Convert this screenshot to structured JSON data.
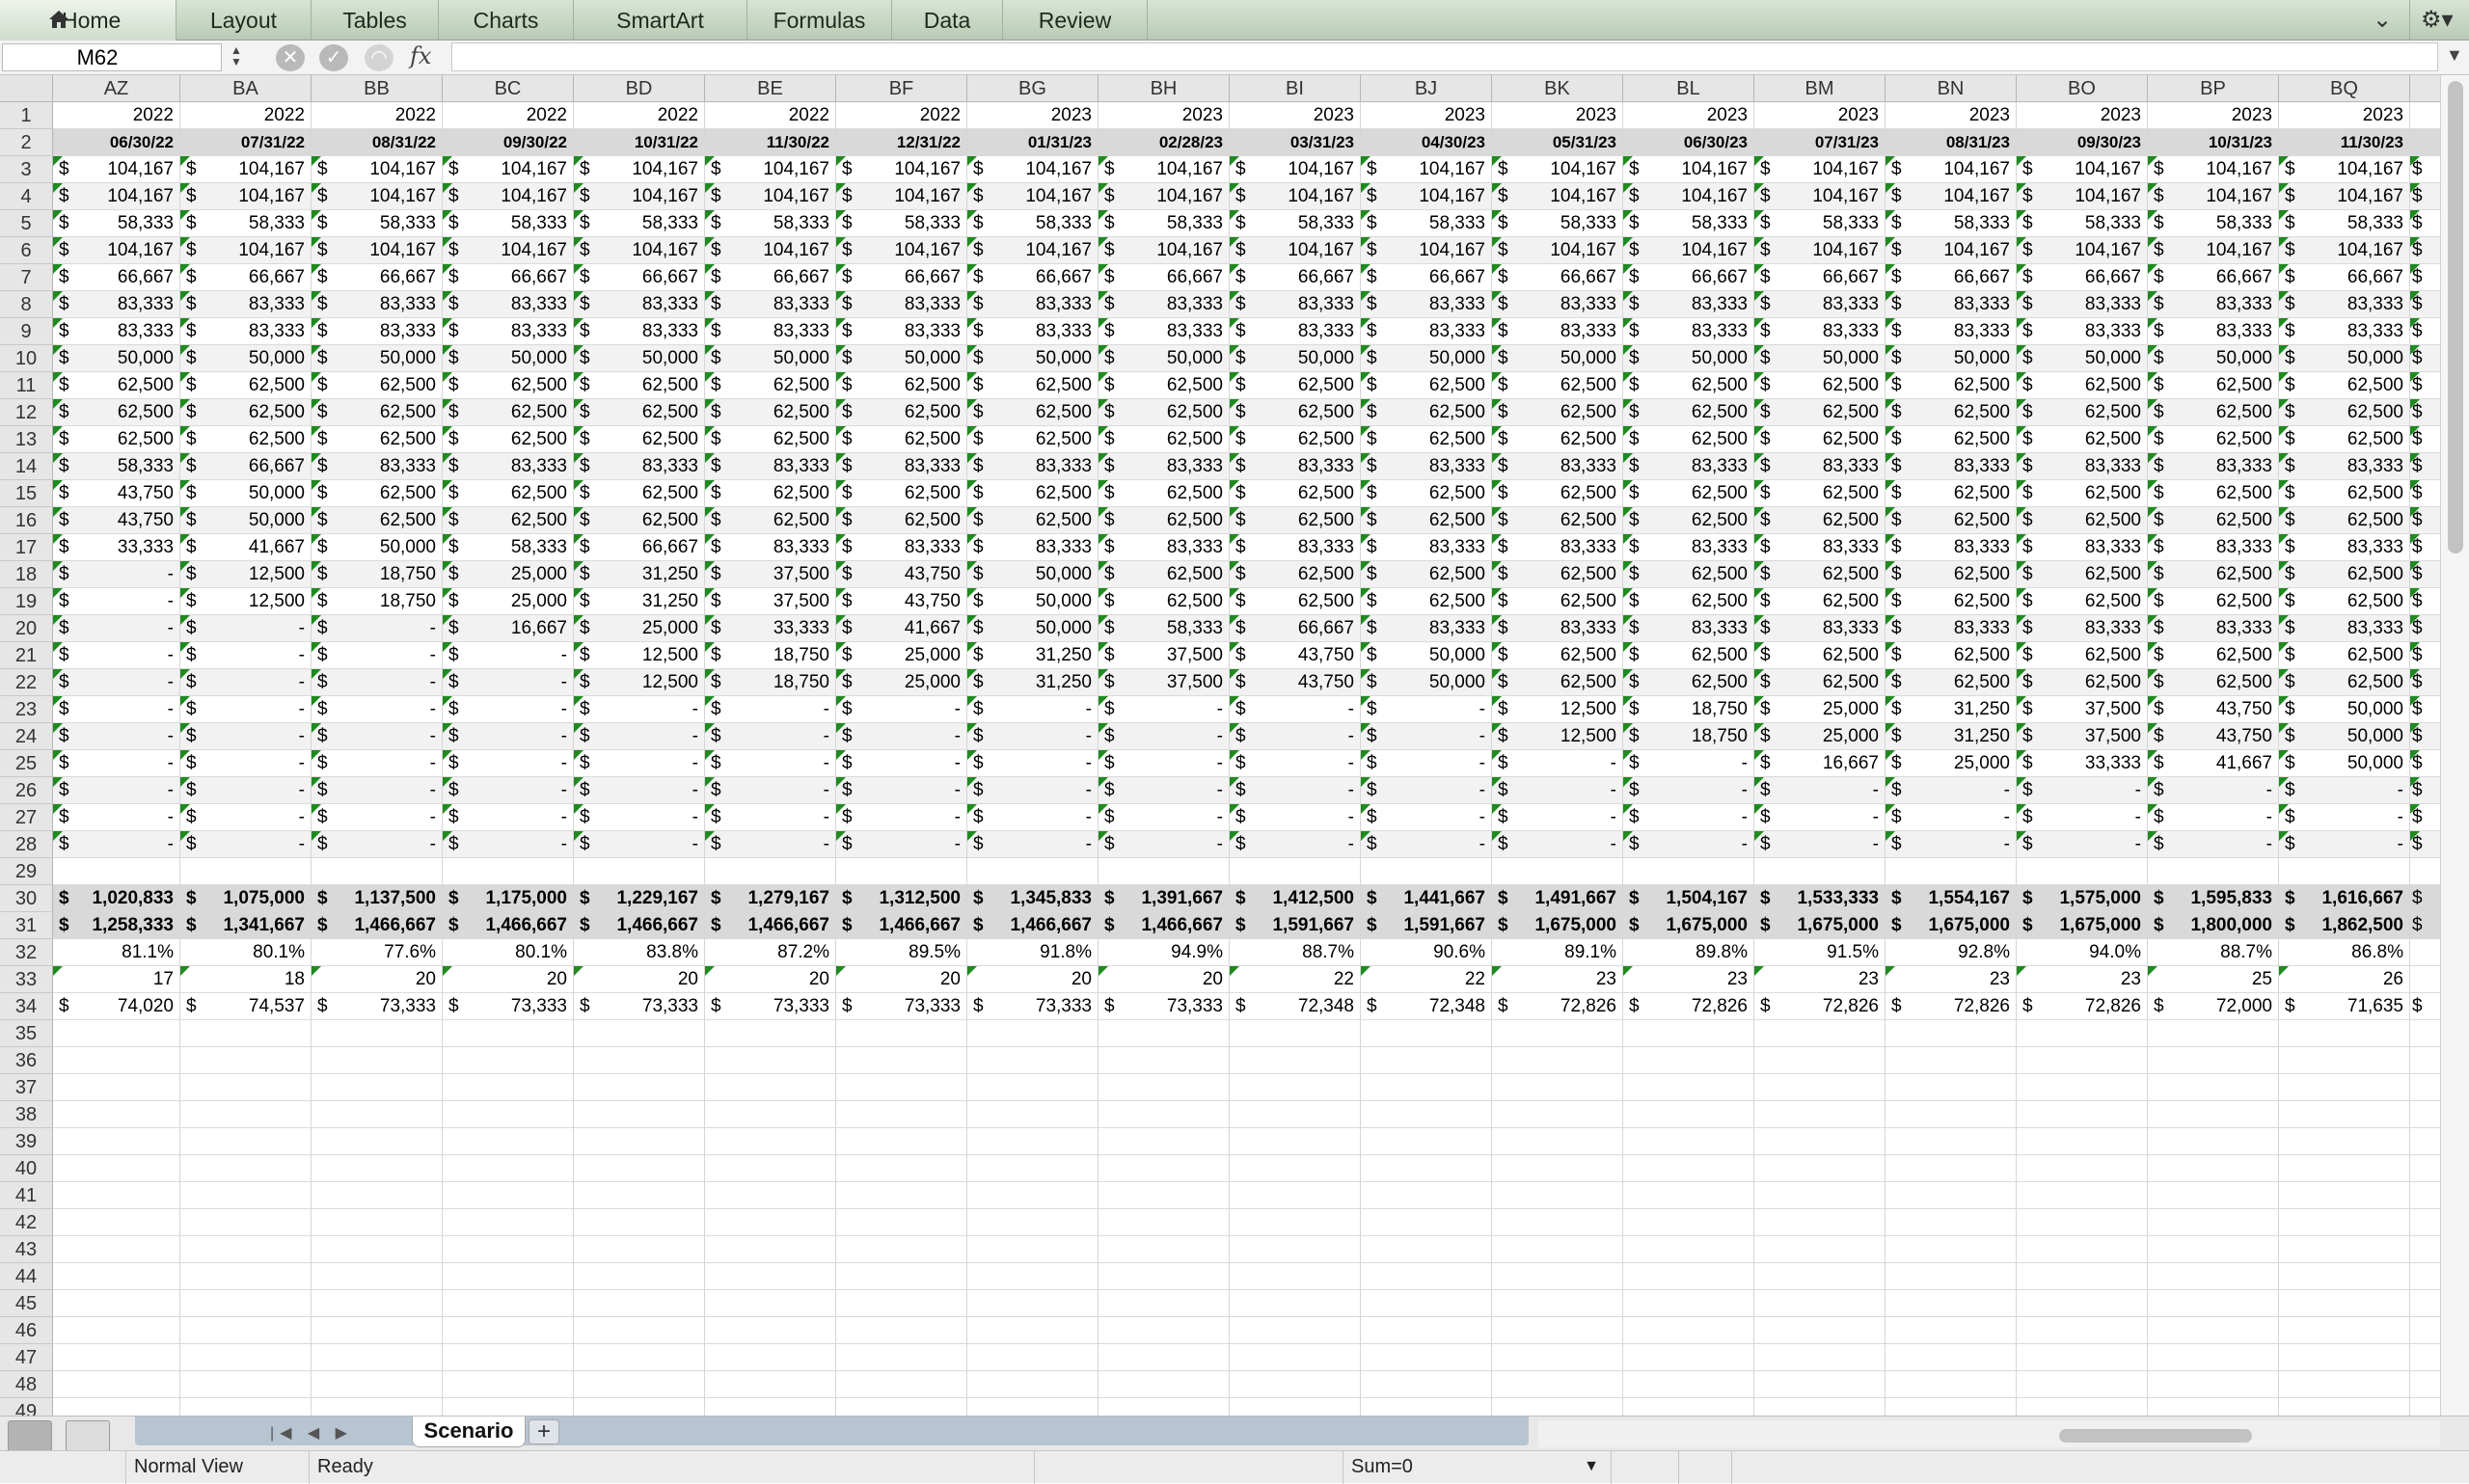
{
  "ribbon": {
    "tabs": [
      "Home",
      "Layout",
      "Tables",
      "Charts",
      "SmartArt",
      "Formulas",
      "Data",
      "Review"
    ],
    "icons": {
      "home": "house-icon",
      "collapse": "chevron-down-icon",
      "settings": "gear-icon"
    }
  },
  "formula_bar": {
    "name_box": "M62",
    "fx_label": "fx",
    "formula": ""
  },
  "grid": {
    "columns": [
      "AZ",
      "BA",
      "BB",
      "BC",
      "BD",
      "BE",
      "BF",
      "BG",
      "BH",
      "BI",
      "BJ",
      "BK",
      "BL",
      "BM",
      "BN",
      "BO",
      "BP",
      "BQ"
    ],
    "row_numbers": [
      "1",
      "2",
      "3",
      "4",
      "5",
      "6",
      "7",
      "8",
      "9",
      "10",
      "11",
      "12",
      "13",
      "14",
      "15",
      "16",
      "17",
      "18",
      "19",
      "20",
      "21",
      "22",
      "23",
      "24",
      "25",
      "26",
      "27",
      "28",
      "29",
      "30",
      "31",
      "32",
      "33",
      "34",
      "35",
      "36",
      "37",
      "38",
      "39",
      "40",
      "41",
      "42",
      "43",
      "44",
      "45",
      "46",
      "47",
      "48",
      "49"
    ],
    "years": [
      "2022",
      "2022",
      "2022",
      "2022",
      "2022",
      "2022",
      "2022",
      "2023",
      "2023",
      "2023",
      "2023",
      "2023",
      "2023",
      "2023",
      "2023",
      "2023",
      "2023",
      "2023"
    ],
    "dates": [
      "06/30/22",
      "07/31/22",
      "08/31/22",
      "09/30/22",
      "10/31/22",
      "11/30/22",
      "12/31/22",
      "01/31/23",
      "02/28/23",
      "03/31/23",
      "04/30/23",
      "05/31/23",
      "06/30/23",
      "07/31/23",
      "08/31/23",
      "09/30/23",
      "10/31/23",
      "11/30/23"
    ],
    "currency_symbol": "$",
    "body_rows": [
      [
        "104,167",
        "104,167",
        "104,167",
        "104,167",
        "104,167",
        "104,167",
        "104,167",
        "104,167",
        "104,167",
        "104,167",
        "104,167",
        "104,167",
        "104,167",
        "104,167",
        "104,167",
        "104,167",
        "104,167",
        "104,167"
      ],
      [
        "104,167",
        "104,167",
        "104,167",
        "104,167",
        "104,167",
        "104,167",
        "104,167",
        "104,167",
        "104,167",
        "104,167",
        "104,167",
        "104,167",
        "104,167",
        "104,167",
        "104,167",
        "104,167",
        "104,167",
        "104,167"
      ],
      [
        "58,333",
        "58,333",
        "58,333",
        "58,333",
        "58,333",
        "58,333",
        "58,333",
        "58,333",
        "58,333",
        "58,333",
        "58,333",
        "58,333",
        "58,333",
        "58,333",
        "58,333",
        "58,333",
        "58,333",
        "58,333"
      ],
      [
        "104,167",
        "104,167",
        "104,167",
        "104,167",
        "104,167",
        "104,167",
        "104,167",
        "104,167",
        "104,167",
        "104,167",
        "104,167",
        "104,167",
        "104,167",
        "104,167",
        "104,167",
        "104,167",
        "104,167",
        "104,167"
      ],
      [
        "66,667",
        "66,667",
        "66,667",
        "66,667",
        "66,667",
        "66,667",
        "66,667",
        "66,667",
        "66,667",
        "66,667",
        "66,667",
        "66,667",
        "66,667",
        "66,667",
        "66,667",
        "66,667",
        "66,667",
        "66,667"
      ],
      [
        "83,333",
        "83,333",
        "83,333",
        "83,333",
        "83,333",
        "83,333",
        "83,333",
        "83,333",
        "83,333",
        "83,333",
        "83,333",
        "83,333",
        "83,333",
        "83,333",
        "83,333",
        "83,333",
        "83,333",
        "83,333"
      ],
      [
        "83,333",
        "83,333",
        "83,333",
        "83,333",
        "83,333",
        "83,333",
        "83,333",
        "83,333",
        "83,333",
        "83,333",
        "83,333",
        "83,333",
        "83,333",
        "83,333",
        "83,333",
        "83,333",
        "83,333",
        "83,333"
      ],
      [
        "50,000",
        "50,000",
        "50,000",
        "50,000",
        "50,000",
        "50,000",
        "50,000",
        "50,000",
        "50,000",
        "50,000",
        "50,000",
        "50,000",
        "50,000",
        "50,000",
        "50,000",
        "50,000",
        "50,000",
        "50,000"
      ],
      [
        "62,500",
        "62,500",
        "62,500",
        "62,500",
        "62,500",
        "62,500",
        "62,500",
        "62,500",
        "62,500",
        "62,500",
        "62,500",
        "62,500",
        "62,500",
        "62,500",
        "62,500",
        "62,500",
        "62,500",
        "62,500"
      ],
      [
        "62,500",
        "62,500",
        "62,500",
        "62,500",
        "62,500",
        "62,500",
        "62,500",
        "62,500",
        "62,500",
        "62,500",
        "62,500",
        "62,500",
        "62,500",
        "62,500",
        "62,500",
        "62,500",
        "62,500",
        "62,500"
      ],
      [
        "62,500",
        "62,500",
        "62,500",
        "62,500",
        "62,500",
        "62,500",
        "62,500",
        "62,500",
        "62,500",
        "62,500",
        "62,500",
        "62,500",
        "62,500",
        "62,500",
        "62,500",
        "62,500",
        "62,500",
        "62,500"
      ],
      [
        "58,333",
        "66,667",
        "83,333",
        "83,333",
        "83,333",
        "83,333",
        "83,333",
        "83,333",
        "83,333",
        "83,333",
        "83,333",
        "83,333",
        "83,333",
        "83,333",
        "83,333",
        "83,333",
        "83,333",
        "83,333"
      ],
      [
        "43,750",
        "50,000",
        "62,500",
        "62,500",
        "62,500",
        "62,500",
        "62,500",
        "62,500",
        "62,500",
        "62,500",
        "62,500",
        "62,500",
        "62,500",
        "62,500",
        "62,500",
        "62,500",
        "62,500",
        "62,500"
      ],
      [
        "43,750",
        "50,000",
        "62,500",
        "62,500",
        "62,500",
        "62,500",
        "62,500",
        "62,500",
        "62,500",
        "62,500",
        "62,500",
        "62,500",
        "62,500",
        "62,500",
        "62,500",
        "62,500",
        "62,500",
        "62,500"
      ],
      [
        "33,333",
        "41,667",
        "50,000",
        "58,333",
        "66,667",
        "83,333",
        "83,333",
        "83,333",
        "83,333",
        "83,333",
        "83,333",
        "83,333",
        "83,333",
        "83,333",
        "83,333",
        "83,333",
        "83,333",
        "83,333"
      ],
      [
        "-",
        "12,500",
        "18,750",
        "25,000",
        "31,250",
        "37,500",
        "43,750",
        "50,000",
        "62,500",
        "62,500",
        "62,500",
        "62,500",
        "62,500",
        "62,500",
        "62,500",
        "62,500",
        "62,500",
        "62,500"
      ],
      [
        "-",
        "12,500",
        "18,750",
        "25,000",
        "31,250",
        "37,500",
        "43,750",
        "50,000",
        "62,500",
        "62,500",
        "62,500",
        "62,500",
        "62,500",
        "62,500",
        "62,500",
        "62,500",
        "62,500",
        "62,500"
      ],
      [
        "-",
        "-",
        "-",
        "16,667",
        "25,000",
        "33,333",
        "41,667",
        "50,000",
        "58,333",
        "66,667",
        "83,333",
        "83,333",
        "83,333",
        "83,333",
        "83,333",
        "83,333",
        "83,333",
        "83,333"
      ],
      [
        "-",
        "-",
        "-",
        "-",
        "12,500",
        "18,750",
        "25,000",
        "31,250",
        "37,500",
        "43,750",
        "50,000",
        "62,500",
        "62,500",
        "62,500",
        "62,500",
        "62,500",
        "62,500",
        "62,500"
      ],
      [
        "-",
        "-",
        "-",
        "-",
        "12,500",
        "18,750",
        "25,000",
        "31,250",
        "37,500",
        "43,750",
        "50,000",
        "62,500",
        "62,500",
        "62,500",
        "62,500",
        "62,500",
        "62,500",
        "62,500"
      ],
      [
        "-",
        "-",
        "-",
        "-",
        "-",
        "-",
        "-",
        "-",
        "-",
        "-",
        "-",
        "12,500",
        "18,750",
        "25,000",
        "31,250",
        "37,500",
        "43,750",
        "50,000"
      ],
      [
        "-",
        "-",
        "-",
        "-",
        "-",
        "-",
        "-",
        "-",
        "-",
        "-",
        "-",
        "12,500",
        "18,750",
        "25,000",
        "31,250",
        "37,500",
        "43,750",
        "50,000"
      ],
      [
        "-",
        "-",
        "-",
        "-",
        "-",
        "-",
        "-",
        "-",
        "-",
        "-",
        "-",
        "-",
        "-",
        "16,667",
        "25,000",
        "33,333",
        "41,667",
        "50,000"
      ],
      [
        "-",
        "-",
        "-",
        "-",
        "-",
        "-",
        "-",
        "-",
        "-",
        "-",
        "-",
        "-",
        "-",
        "-",
        "-",
        "-",
        "-",
        "-"
      ],
      [
        "-",
        "-",
        "-",
        "-",
        "-",
        "-",
        "-",
        "-",
        "-",
        "-",
        "-",
        "-",
        "-",
        "-",
        "-",
        "-",
        "-",
        "-"
      ],
      [
        "-",
        "-",
        "-",
        "-",
        "-",
        "-",
        "-",
        "-",
        "-",
        "-",
        "-",
        "-",
        "-",
        "-",
        "-",
        "-",
        "-",
        "-"
      ]
    ],
    "totals_row30": [
      "1,020,833",
      "1,075,000",
      "1,137,500",
      "1,175,000",
      "1,229,167",
      "1,279,167",
      "1,312,500",
      "1,345,833",
      "1,391,667",
      "1,412,500",
      "1,441,667",
      "1,491,667",
      "1,504,167",
      "1,533,333",
      "1,554,167",
      "1,575,000",
      "1,595,833",
      "1,616,667"
    ],
    "totals_row31": [
      "1,258,333",
      "1,341,667",
      "1,466,667",
      "1,466,667",
      "1,466,667",
      "1,466,667",
      "1,466,667",
      "1,466,667",
      "1,466,667",
      "1,591,667",
      "1,591,667",
      "1,675,000",
      "1,675,000",
      "1,675,000",
      "1,675,000",
      "1,675,000",
      "1,800,000",
      "1,862,500"
    ],
    "percent_row32": [
      "81.1%",
      "80.1%",
      "77.6%",
      "80.1%",
      "83.8%",
      "87.2%",
      "89.5%",
      "91.8%",
      "94.9%",
      "88.7%",
      "90.6%",
      "89.1%",
      "89.8%",
      "91.5%",
      "92.8%",
      "94.0%",
      "88.7%",
      "86.8%"
    ],
    "count_row33": [
      "17",
      "18",
      "20",
      "20",
      "20",
      "20",
      "20",
      "20",
      "20",
      "22",
      "22",
      "23",
      "23",
      "23",
      "23",
      "23",
      "25",
      "26"
    ],
    "avg_row34": [
      "74,020",
      "74,537",
      "73,333",
      "73,333",
      "73,333",
      "73,333",
      "73,333",
      "73,333",
      "73,333",
      "72,348",
      "72,348",
      "72,826",
      "72,826",
      "72,826",
      "72,826",
      "72,826",
      "72,000",
      "71,635"
    ]
  },
  "sheet_tabs": {
    "active": "Scenario",
    "add": "+",
    "nav": "|◀ ◀ ▶ ▶|"
  },
  "status_bar": {
    "view": "Normal View",
    "state": "Ready",
    "sum": "Sum=0"
  }
}
